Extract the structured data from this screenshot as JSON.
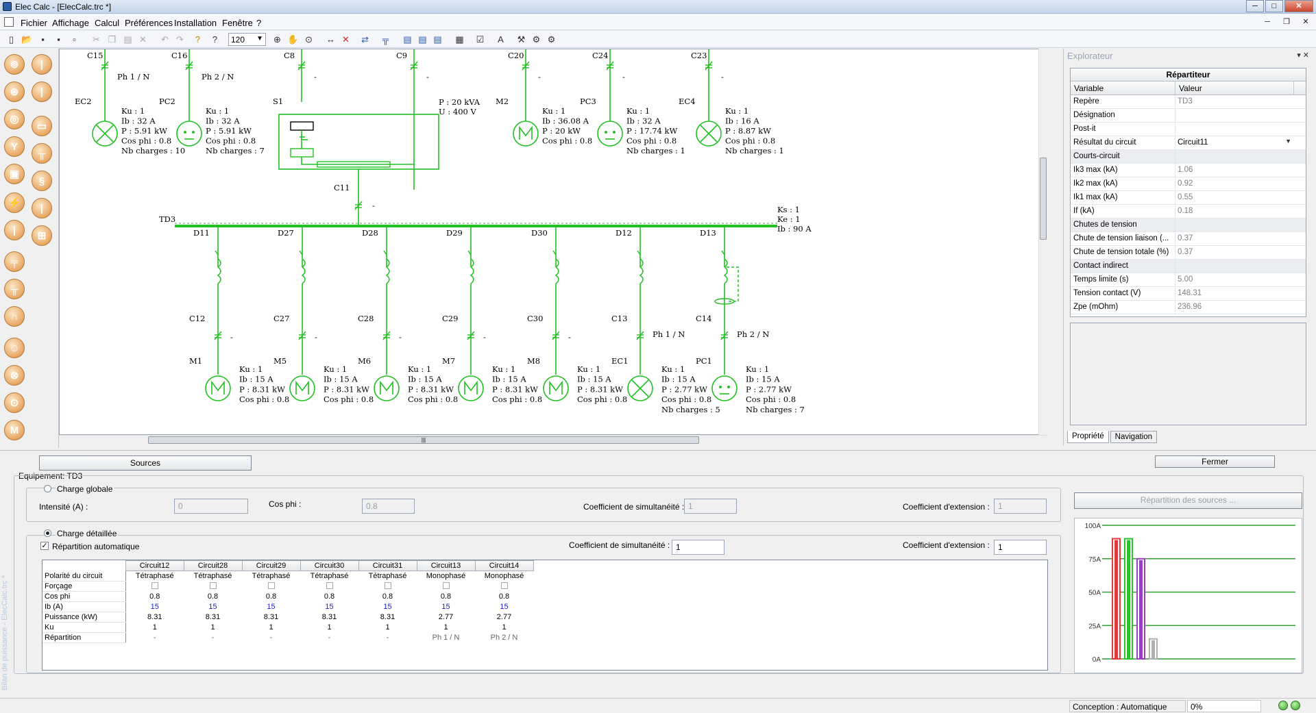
{
  "window": {
    "title": "Elec Calc - [ElecCalc.trc *]",
    "min": "─",
    "max": "□",
    "close": "✕"
  },
  "menu": {
    "items": [
      "Fichier",
      "Affichage",
      "Calcul",
      "Préférences",
      "Installation",
      "Fenêtre",
      "?"
    ],
    "mdi": {
      "min": "─",
      "restore": "❐",
      "close": "✕"
    }
  },
  "toolbar": {
    "zoom": "120"
  },
  "diagram": {
    "top_row": [
      {
        "breaker": "C15",
        "phase": "Ph 1 / N",
        "load": "EC2",
        "type": "lamp",
        "specs": [
          "Ku : 1",
          "Ib : 32 A",
          "P : 5.91 kW",
          "Cos phi : 0.8",
          "Nb charges : 10"
        ]
      },
      {
        "breaker": "C16",
        "phase": "Ph 2 / N",
        "load": "PC2",
        "type": "socket",
        "specs": [
          "Ku : 1",
          "Ib : 32 A",
          "P : 5.91 kW",
          "Cos phi : 0.8",
          "Nb charges : 7"
        ]
      },
      {
        "breaker": "C8",
        "phase": "-",
        "load": "S1",
        "type": "source",
        "specs": []
      },
      {
        "breaker": "C9",
        "phase": "-",
        "load": "",
        "type": "source-return",
        "specs": [
          "P : 20 kVA",
          "U : 400 V"
        ]
      },
      {
        "breaker": "C20",
        "phase": "-",
        "load": "M2",
        "type": "motor",
        "specs": [
          "Ku : 1",
          "Ib : 36.08 A",
          "P : 20 kW",
          "Cos phi : 0.8"
        ]
      },
      {
        "breaker": "C24",
        "phase": "-",
        "load": "PC3",
        "type": "socket",
        "specs": [
          "Ku : 1",
          "Ib : 32 A",
          "P : 17.74 kW",
          "Cos phi : 0.8",
          "Nb charges : 1"
        ]
      },
      {
        "breaker": "C23",
        "phase": "-",
        "load": "EC4",
        "type": "lamp",
        "specs": [
          "Ku : 1",
          "Ib : 16 A",
          "P : 8.87 kW",
          "Cos phi : 0.8",
          "Nb charges : 1"
        ]
      }
    ],
    "feeder": {
      "breaker": "C11",
      "phase": "-"
    },
    "busbar": {
      "name": "TD3",
      "specs": [
        "Ks : 1",
        "Ke : 1",
        "Ib : 90 A"
      ]
    },
    "bottom_row": [
      {
        "disconnect": "D11",
        "breaker": "C12",
        "phase": "-",
        "load": "M1",
        "type": "motor",
        "specs": [
          "Ku : 1",
          "Ib : 15 A",
          "P : 8.31 kW",
          "Cos phi : 0.8"
        ]
      },
      {
        "disconnect": "D27",
        "breaker": "C27",
        "phase": "-",
        "load": "M5",
        "type": "motor",
        "specs": [
          "Ku : 1",
          "Ib : 15 A",
          "P : 8.31 kW",
          "Cos phi : 0.8"
        ]
      },
      {
        "disconnect": "D28",
        "breaker": "C28",
        "phase": "-",
        "load": "M6",
        "type": "motor",
        "specs": [
          "Ku : 1",
          "Ib : 15 A",
          "P : 8.31 kW",
          "Cos phi : 0.8"
        ]
      },
      {
        "disconnect": "D29",
        "breaker": "C29",
        "phase": "-",
        "load": "M7",
        "type": "motor",
        "specs": [
          "Ku : 1",
          "Ib : 15 A",
          "P : 8.31 kW",
          "Cos phi : 0.8"
        ]
      },
      {
        "disconnect": "D30",
        "breaker": "C30",
        "phase": "-",
        "load": "M8",
        "type": "motor",
        "specs": [
          "Ku : 1",
          "Ib : 15 A",
          "P : 8.31 kW",
          "Cos phi : 0.8"
        ]
      },
      {
        "disconnect": "D12",
        "breaker": "C13",
        "phase": "Ph 1 / N",
        "load": "EC1",
        "type": "lamp",
        "specs": [
          "Ku : 1",
          "Ib : 15 A",
          "P : 2.77 kW",
          "Cos phi : 0.8",
          "Nb charges : 5"
        ]
      },
      {
        "disconnect": "D13",
        "breaker": "C14",
        "phase": "Ph 2 / N",
        "load": "PC1",
        "type": "socket",
        "specs": [
          "Ku : 1",
          "Ib : 15 A",
          "P : 2.77 kW",
          "Cos phi : 0.8",
          "Nb charges : 7"
        ]
      }
    ],
    "color": "#22c022"
  },
  "explorer": {
    "title": "Explorateur",
    "pin": "▾ ✕",
    "header": "Répartiteur",
    "col_variable": "Variable",
    "col_value": "Valeur",
    "rows": [
      {
        "k": "Repère",
        "v": "TD3"
      },
      {
        "k": "Désignation",
        "v": ""
      },
      {
        "k": "Post-it",
        "v": ""
      },
      {
        "k": "Résultat du circuit",
        "v": "Circuit11"
      },
      {
        "k": "Courts-circuit",
        "v": "",
        "group": true
      },
      {
        "k": "Ik3 max (kA)",
        "v": "1.06"
      },
      {
        "k": "Ik2 max (kA)",
        "v": "0.92"
      },
      {
        "k": "Ik1 max (kA)",
        "v": "0.55"
      },
      {
        "k": "If (kA)",
        "v": "0.18"
      },
      {
        "k": "Chutes de tension",
        "v": "",
        "group": true
      },
      {
        "k": "Chute de tension liaison (...",
        "v": "0.37"
      },
      {
        "k": "Chute de tension totale (%)",
        "v": "0.37"
      },
      {
        "k": "Contact indirect",
        "v": "",
        "group": true
      },
      {
        "k": "Temps limite (s)",
        "v": "5.00"
      },
      {
        "k": "Tension contact (V)",
        "v": "148.31"
      },
      {
        "k": "Zpe (mOhm)",
        "v": "236.96"
      }
    ],
    "tabs": [
      "Propriété",
      "Navigation"
    ]
  },
  "bilan": {
    "sources_btn": "Sources",
    "fermer_btn": "Fermer",
    "equipement": "Equipement: TD3",
    "charge_globale": "Charge globale",
    "intensite_label": "Intensité (A) :",
    "intensite_value": "0",
    "cosphi_label": "Cos phi :",
    "cosphi_value": "0.8",
    "coef_simult_label": "Coefficient de simultanéité :",
    "coef_simult_global": "1",
    "coef_ext_label": "Coefficient d'extension :",
    "coef_ext_global": "1",
    "repartition_btn": "Répartition des sources ...",
    "charge_detaillee": "Charge détaillée",
    "repartition_auto": "Répartition automatique",
    "coef_simult_detail": "1",
    "coef_ext_detail": "1",
    "columns": [
      "Circuit12",
      "Circuit28",
      "Circuit29",
      "Circuit30",
      "Circuit31",
      "Circuit13",
      "Circuit14"
    ],
    "row_labels": [
      "Polarité du circuit",
      "Forçage",
      "Cos phi",
      "Ib (A)",
      "Puissance (kW)",
      "Ku",
      "Répartition"
    ],
    "polarite": [
      "Tétraphasé",
      "Tétraphasé",
      "Tétraphasé",
      "Tétraphasé",
      "Tétraphasé",
      "Monophasé",
      "Monophasé"
    ],
    "cosphi": [
      "0.8",
      "0.8",
      "0.8",
      "0.8",
      "0.8",
      "0.8",
      "0.8"
    ],
    "ib": [
      "15",
      "15",
      "15",
      "15",
      "15",
      "15",
      "15"
    ],
    "puissance": [
      "8.31",
      "8.31",
      "8.31",
      "8.31",
      "8.31",
      "2.77",
      "2.77"
    ],
    "ku": [
      "1",
      "1",
      "1",
      "1",
      "1",
      "1",
      "1"
    ],
    "repartition": [
      "-",
      "-",
      "-",
      "-",
      "-",
      "Ph 1 / N",
      "Ph 2 / N"
    ],
    "side_label": "Bilan de puissance - ElecCalc.trc *"
  },
  "chart_data": {
    "type": "bar",
    "title": "",
    "xlabel": "",
    "ylabel": "",
    "ylim": [
      0,
      100
    ],
    "y_ticks": [
      "0A",
      "25A",
      "50A",
      "75A",
      "100A"
    ],
    "categories": [
      "",
      "",
      "",
      ""
    ],
    "values": [
      90,
      90,
      75,
      15
    ],
    "colors": [
      "#e23a3a",
      "#2fc22f",
      "#9b3fc1",
      "#b0b0b0"
    ],
    "grid": true
  },
  "status": {
    "conception": "Conception : Automatique",
    "progress": "0%",
    "progress_value": 0
  }
}
